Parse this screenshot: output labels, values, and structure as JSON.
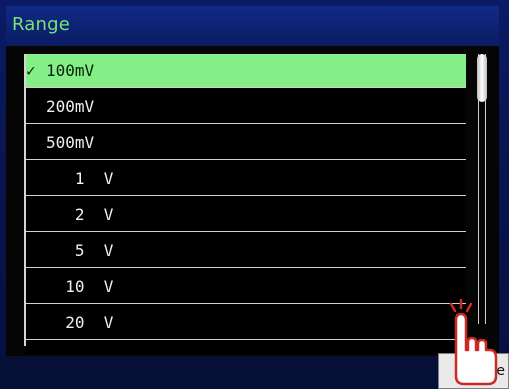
{
  "dialog": {
    "title": "Range"
  },
  "range_list": {
    "items": [
      {
        "label": "100mV",
        "selected": true,
        "check": "✓"
      },
      {
        "label": "200mV",
        "selected": false,
        "check": ""
      },
      {
        "label": "500mV",
        "selected": false,
        "check": ""
      },
      {
        "label": "   1  V",
        "selected": false,
        "check": ""
      },
      {
        "label": "   2  V",
        "selected": false,
        "check": ""
      },
      {
        "label": "   5  V",
        "selected": false,
        "check": ""
      },
      {
        "label": "  10  V",
        "selected": false,
        "check": ""
      },
      {
        "label": "  20  V",
        "selected": false,
        "check": ""
      }
    ]
  },
  "bottom_button": {
    "label": "e"
  },
  "colors": {
    "title_text": "#78e37a",
    "selected_row": "#83ef86",
    "background": "#0a1652"
  },
  "icons": {
    "touch_hint": "hand-touch-icon"
  }
}
